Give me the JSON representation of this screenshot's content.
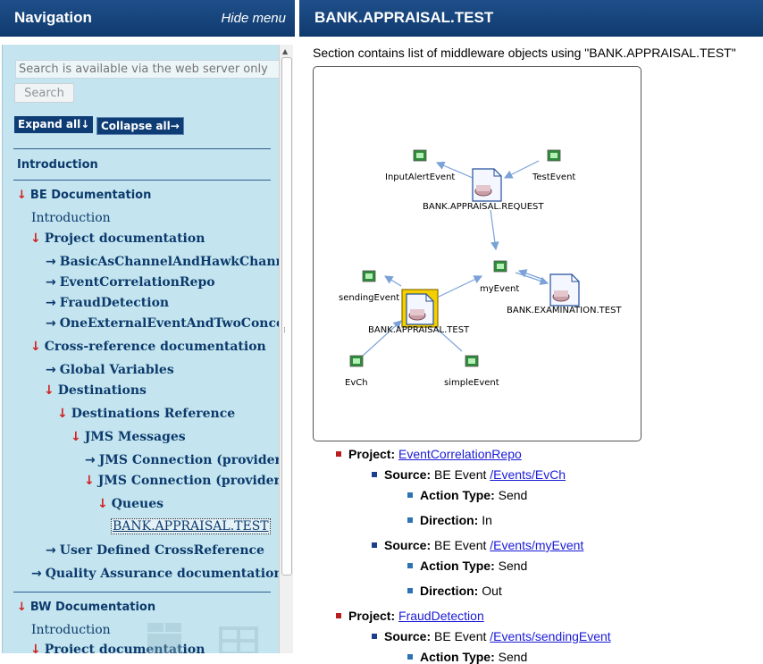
{
  "nav": {
    "title": "Navigation",
    "hide_menu": "Hide menu",
    "search_placeholder": "Search is available via the web server only",
    "search_button": "Search",
    "expand_all": "Expand all↓",
    "collapse_all": "Collapse all→",
    "items": [
      {
        "label": "Introduction"
      },
      {
        "label": "BE Documentation"
      },
      {
        "label": "Introduction"
      },
      {
        "label": "Project documentation"
      },
      {
        "label": "BasicAsChannelAndHawkChannel"
      },
      {
        "label": "EventCorrelationRepo"
      },
      {
        "label": "FraudDetection"
      },
      {
        "label": "OneExternalEventAndTwoConcept"
      },
      {
        "label": "Cross-reference documentation"
      },
      {
        "label": "Global Variables"
      },
      {
        "label": "Destinations"
      },
      {
        "label": "Destinations Reference"
      },
      {
        "label": "JMS Messages"
      },
      {
        "label": "JMS Connection (provider U"
      },
      {
        "label": "JMS Connection (provider U"
      },
      {
        "label": "Queues"
      },
      {
        "label": "BANK.APPRAISAL.TEST"
      },
      {
        "label": "User Defined CrossReference"
      },
      {
        "label": "Quality Assurance documentation"
      },
      {
        "label": "BW Documentation"
      },
      {
        "label": "Introduction"
      },
      {
        "label": "Project documentation"
      }
    ]
  },
  "main": {
    "title": "BANK.APPRAISAL.TEST",
    "intro": "Section contains list of middleware objects using \"BANK.APPRAISAL.TEST\"",
    "diagram": {
      "nodes": [
        {
          "label": "InputAlertEvent"
        },
        {
          "label": "TestEvent"
        },
        {
          "label": "BANK.APPRAISAL.REQUEST"
        },
        {
          "label": "sendingEvent"
        },
        {
          "label": "myEvent"
        },
        {
          "label": "BANK.EXAMINATION.TEST"
        },
        {
          "label": "BANK.APPRAISAL.TEST"
        },
        {
          "label": "EvCh"
        },
        {
          "label": "simpleEvent"
        }
      ]
    },
    "labels": {
      "project": "Project:",
      "source": "Source:",
      "be_event": "BE Event",
      "action_type": "Action Type:",
      "direction": "Direction:"
    },
    "projects": [
      {
        "name": "EventCorrelationRepo",
        "sources": [
          {
            "path": "/Events/EvCh",
            "action": "Send",
            "direction": "In"
          },
          {
            "path": "/Events/myEvent",
            "action": "Send",
            "direction": "Out"
          }
        ]
      },
      {
        "name": "FraudDetection",
        "sources": [
          {
            "path": "/Events/sendingEvent",
            "action": "Send"
          }
        ]
      }
    ]
  },
  "colors": {
    "header_blue": "#0f3a6e",
    "nav_bg": "#c4e5ef",
    "link": "#1a1ad6",
    "arrow_red": "#d22020"
  }
}
